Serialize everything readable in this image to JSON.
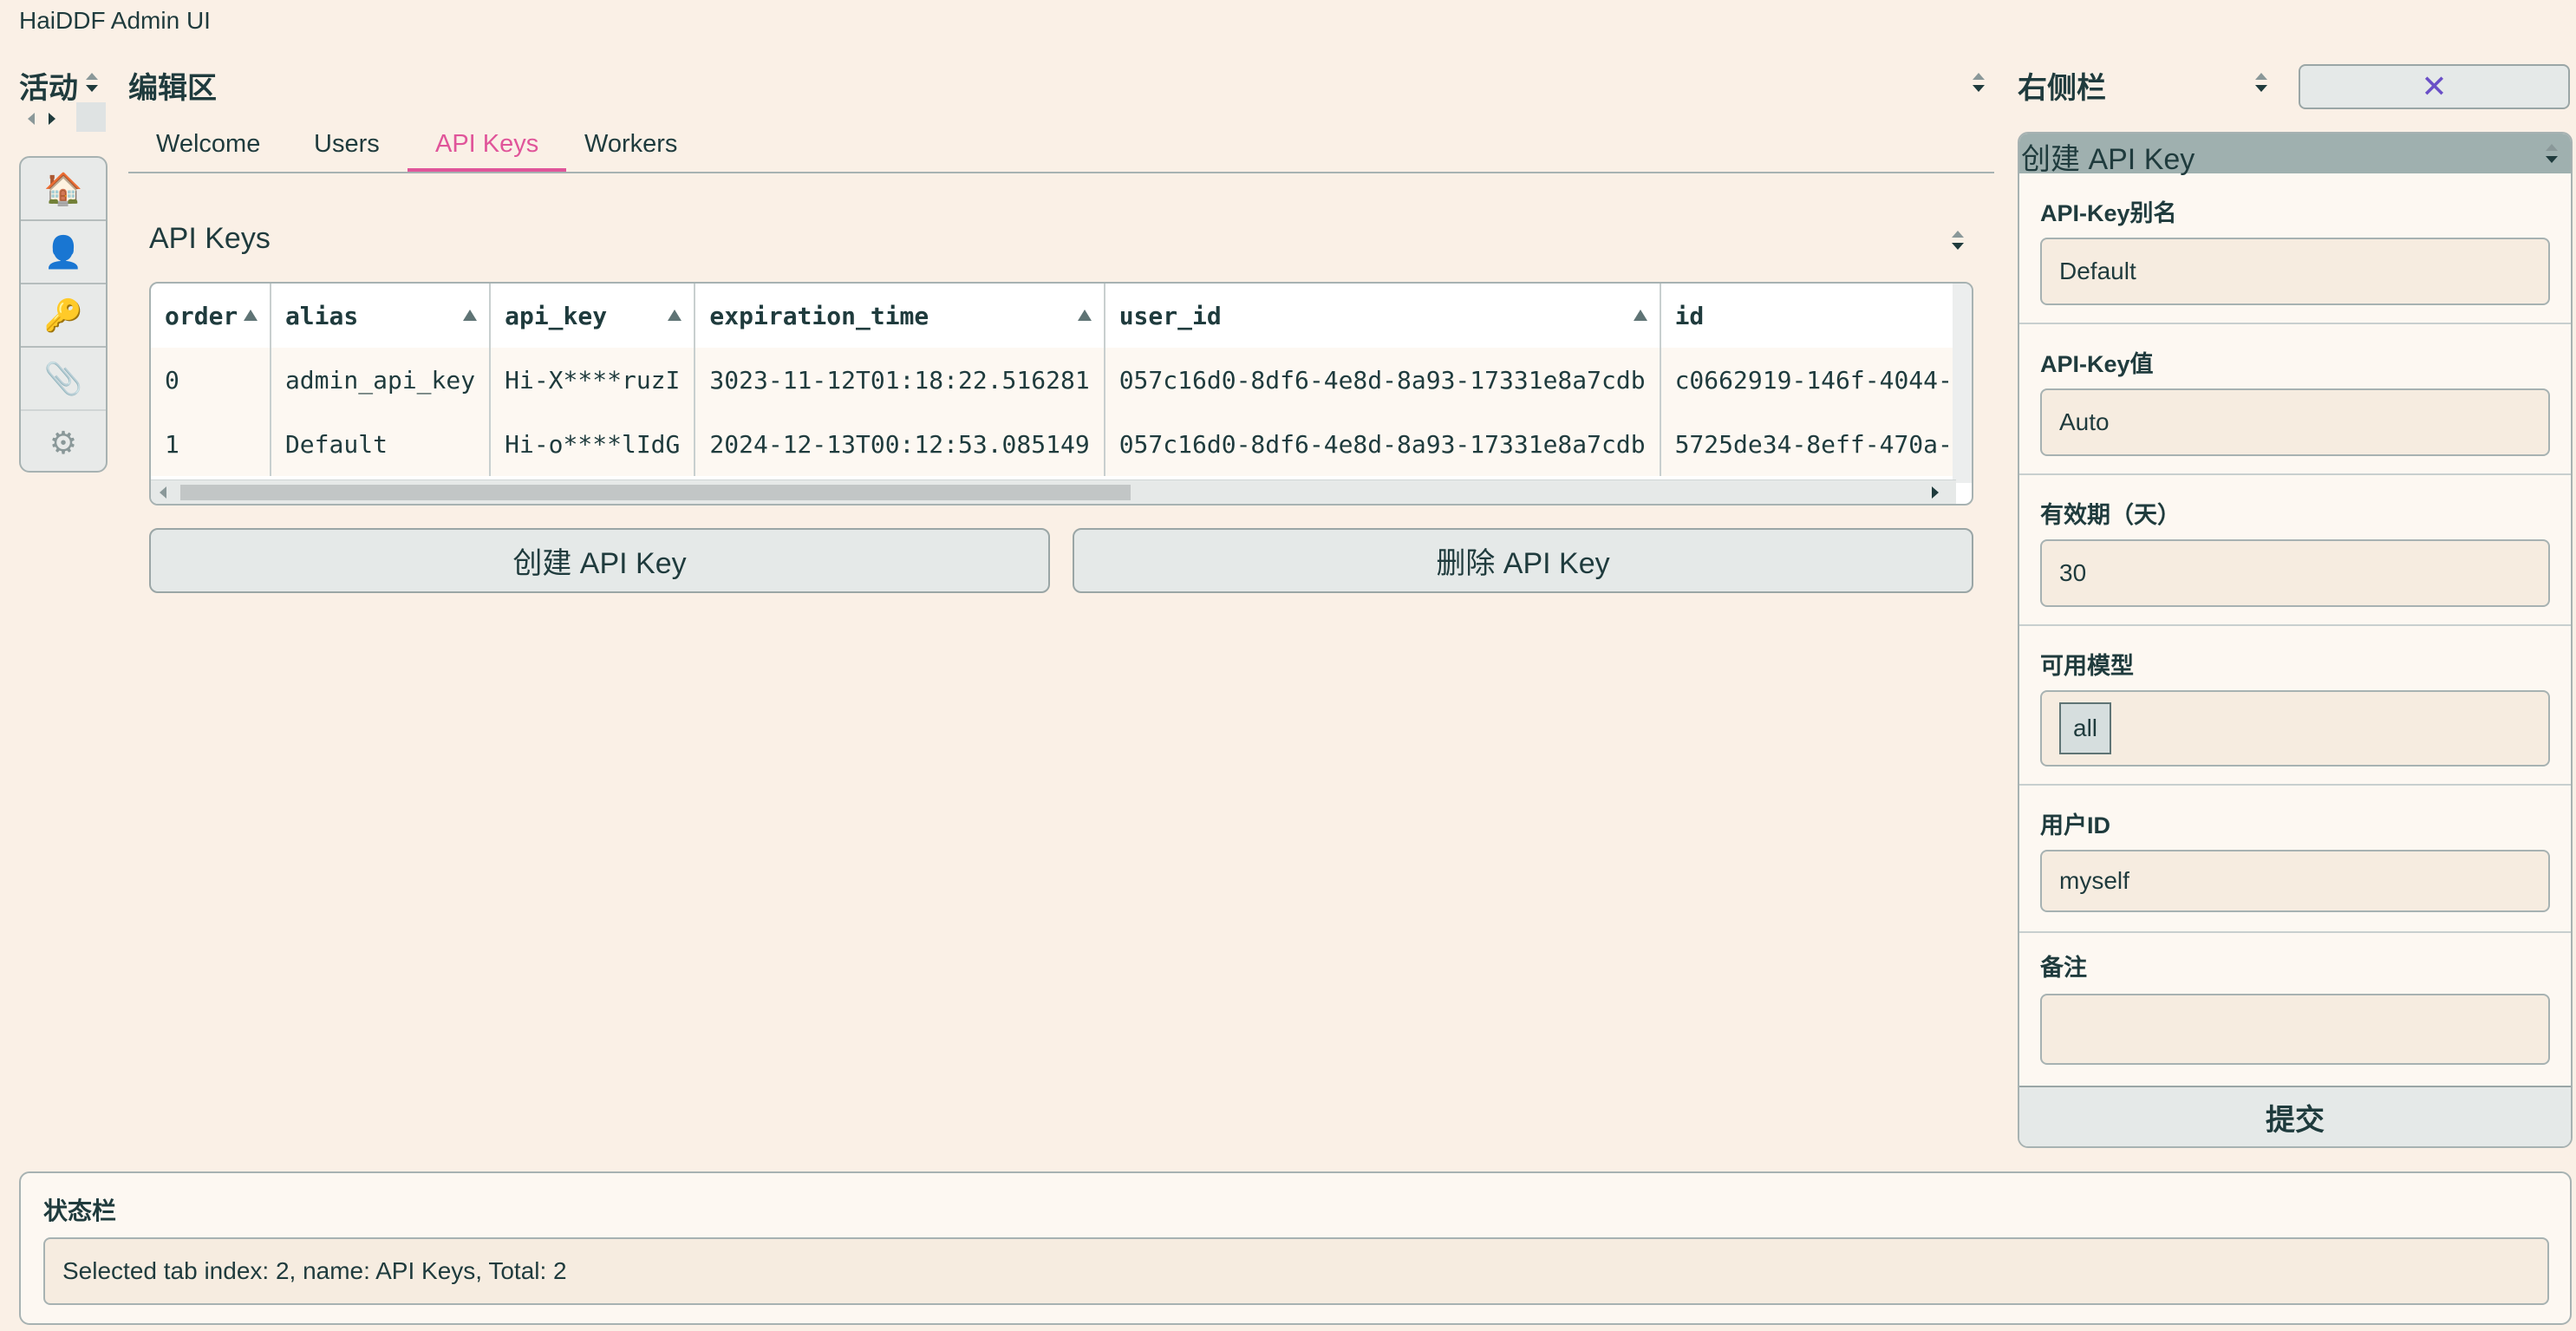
{
  "app_title": "HaiDDF Admin UI",
  "activity": {
    "title": "活动",
    "items": [
      {
        "name": "home",
        "glyph": "🏠"
      },
      {
        "name": "user",
        "glyph": "👤"
      },
      {
        "name": "key",
        "glyph": "🔑"
      },
      {
        "name": "paperclip",
        "glyph": "📎"
      },
      {
        "name": "gear",
        "glyph": "⚙"
      }
    ]
  },
  "editor": {
    "title": "编辑区",
    "tabs": [
      "Welcome",
      "Users",
      "API Keys",
      "Workers"
    ],
    "active_tab": 2,
    "section_title": "API Keys",
    "table": {
      "columns": [
        "order",
        "alias",
        "api_key",
        "expiration_time",
        "user_id",
        "id"
      ],
      "rows": [
        [
          "0",
          "admin_api_key",
          "Hi-X****ruzI",
          "3023-11-12T01:18:22.516281",
          "057c16d0-8df6-4e8d-8a93-17331e8a7cdb",
          "c0662919-146f-4044-"
        ],
        [
          "1",
          "Default",
          "Hi-o****lIdG",
          "2024-12-13T00:12:53.085149",
          "057c16d0-8df6-4e8d-8a93-17331e8a7cdb",
          "5725de34-8eff-470a-"
        ]
      ]
    },
    "create_button": "创建 API Key",
    "delete_button": "删除 API Key"
  },
  "sidebar": {
    "title": "右侧栏",
    "close_glyph": "✕",
    "panel_title": "创建 API Key",
    "fields": [
      {
        "label": "API-Key别名",
        "value": "Default"
      },
      {
        "label": "API-Key值",
        "value": "Auto"
      },
      {
        "label": "有效期（天）",
        "value": "30"
      },
      {
        "label": "可用模型",
        "chip": "all"
      },
      {
        "label": "用户ID",
        "value": "myself"
      },
      {
        "label": "备注",
        "value": ""
      }
    ],
    "submit": "提交"
  },
  "status": {
    "label": "状态栏",
    "text": "Selected tab index: 2, name: API Keys, Total: 2"
  },
  "colors": {
    "background": "#faf0e6",
    "accent": "#e0559a",
    "text": "#1f3b3d",
    "close_icon": "#6a4fc7"
  }
}
